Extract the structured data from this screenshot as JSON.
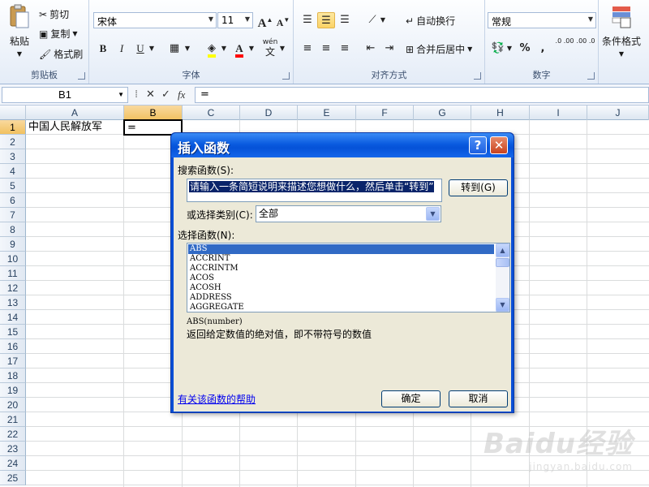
{
  "ribbon": {
    "clipboard": {
      "label": "剪贴板",
      "paste": "粘贴",
      "cut": "剪切",
      "copy": "复制",
      "format_painter": "格式刷"
    },
    "font": {
      "label": "字体",
      "font_name": "宋体",
      "font_size": "11",
      "bold": "B",
      "italic": "I",
      "underline": "U",
      "grow": "A",
      "shrink": "A",
      "font_color_letter": "A",
      "phonetic": "wén"
    },
    "alignment": {
      "label": "对齐方式",
      "wrap_text": "自动换行",
      "merge_center": "合并后居中"
    },
    "number": {
      "label": "数字",
      "format": "常规",
      "percent": "%",
      "comma": ",",
      "increase_decimal": ".0 .00",
      "decrease_decimal": ".00 .0"
    },
    "styles": {
      "conditional_format": "条件格式"
    }
  },
  "formula_bar": {
    "name_box": "B1",
    "formula": "="
  },
  "grid": {
    "columns": [
      "A",
      "B",
      "C",
      "D",
      "E",
      "F",
      "G",
      "H",
      "I",
      "J"
    ],
    "rows": [
      "1",
      "2",
      "3",
      "4",
      "5",
      "6",
      "7",
      "8",
      "9",
      "10",
      "11",
      "12",
      "13",
      "14",
      "15",
      "16",
      "17",
      "18",
      "19",
      "20",
      "21",
      "22",
      "23",
      "24",
      "25"
    ],
    "cells": {
      "A1": "中国人民解放军",
      "B1": "="
    },
    "active_cell": "B1"
  },
  "dialog": {
    "title": "插入函数",
    "help_glyph": "?",
    "close_glyph": "✕",
    "search_label": "搜索函数(S):",
    "search_text": "请输入一条简短说明来描述您想做什么，然后单击“转到”",
    "goto_button": "转到(G)",
    "category_label": "或选择类别(C):",
    "category_value": "全部",
    "select_label": "选择函数(N):",
    "functions": [
      "ABS",
      "ACCRINT",
      "ACCRINTM",
      "ACOS",
      "ACOSH",
      "ADDRESS",
      "AGGREGATE"
    ],
    "selected_function": "ABS",
    "signature": "ABS(number)",
    "description": "返回给定数值的绝对值，即不带符号的数值",
    "help_link": "有关该函数的帮助",
    "ok_button": "确定",
    "cancel_button": "取消"
  },
  "watermark": {
    "brand": "Baidu经验",
    "url": "jingyan.baidu.com"
  }
}
